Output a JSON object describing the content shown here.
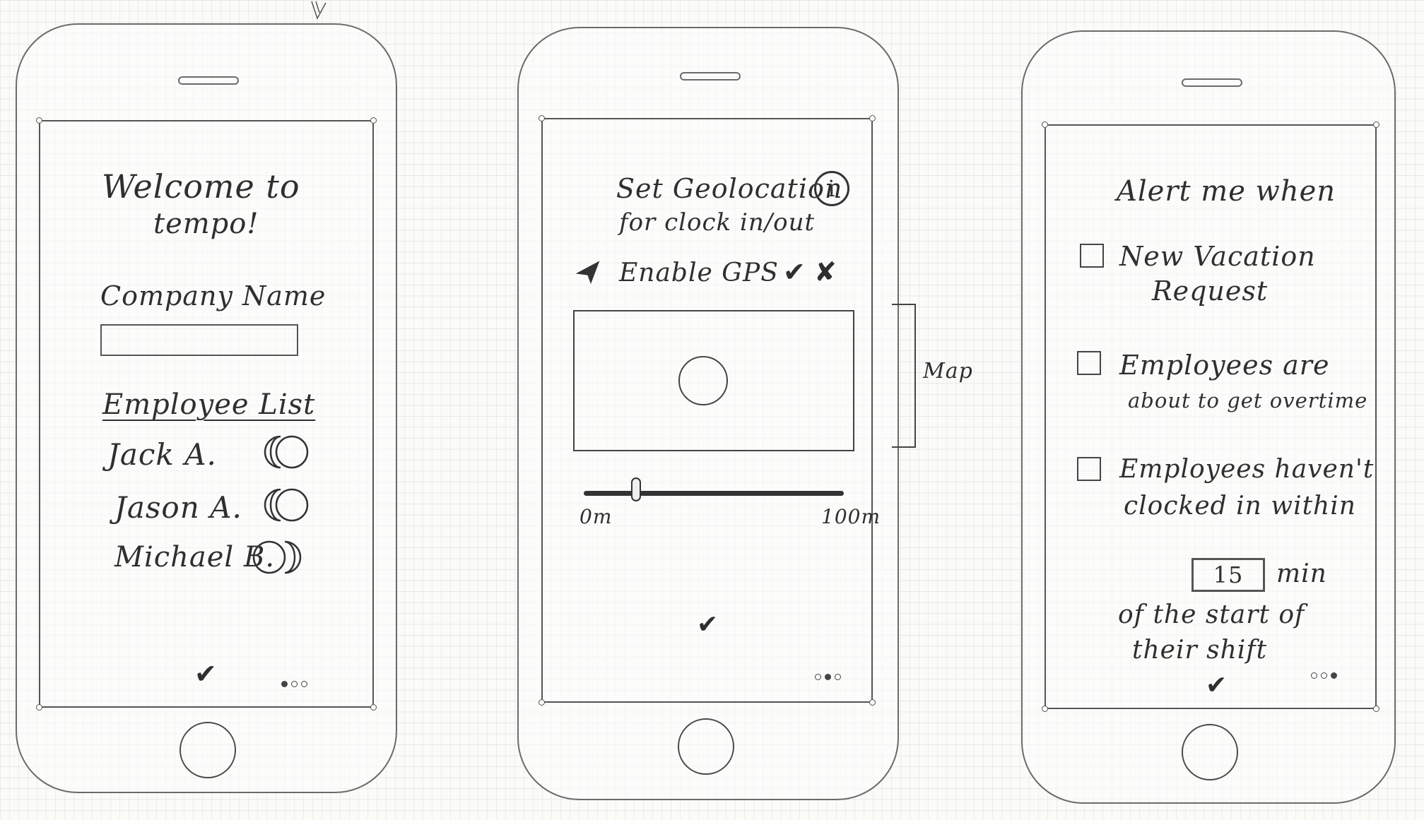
{
  "screens": [
    {
      "welcome": [
        "Welcome to",
        "tempo!"
      ],
      "company_label": "Company Name",
      "company_value": "",
      "employee_header": "Employee List",
      "employees": [
        {
          "name": "Jack A.",
          "toggle": "on"
        },
        {
          "name": "Jason A.",
          "toggle": "on"
        },
        {
          "name": "Michael B.",
          "toggle": "off"
        }
      ],
      "confirm": "✔",
      "pager": {
        "count": 3,
        "active": 1
      }
    },
    {
      "title": [
        "Set Geolocation",
        "for clock in/out"
      ],
      "info": "i",
      "gps_label": "Enable GPS",
      "gps_check": "✔",
      "gps_cross": "✘",
      "map_annotation": "Map",
      "radius_min": "0m",
      "radius_max": "100m",
      "radius_value": 0.2,
      "confirm": "✔",
      "pager": {
        "count": 3,
        "active": 2
      }
    },
    {
      "title": "Alert me when",
      "alerts": [
        [
          "New Vacation",
          "Request"
        ],
        [
          "Employees are",
          "about to get overtime"
        ],
        [
          "Employees haven't",
          "clocked in within"
        ]
      ],
      "minutes_value": "15",
      "minutes_unit": "min",
      "shift_text": [
        "of the start of",
        "their shift"
      ],
      "confirm": "✔",
      "pager": {
        "count": 3,
        "active": 3
      }
    }
  ],
  "colors": {
    "ink": "#333333",
    "paper": "#fbfbf8",
    "grid": "#9fb3c8"
  }
}
